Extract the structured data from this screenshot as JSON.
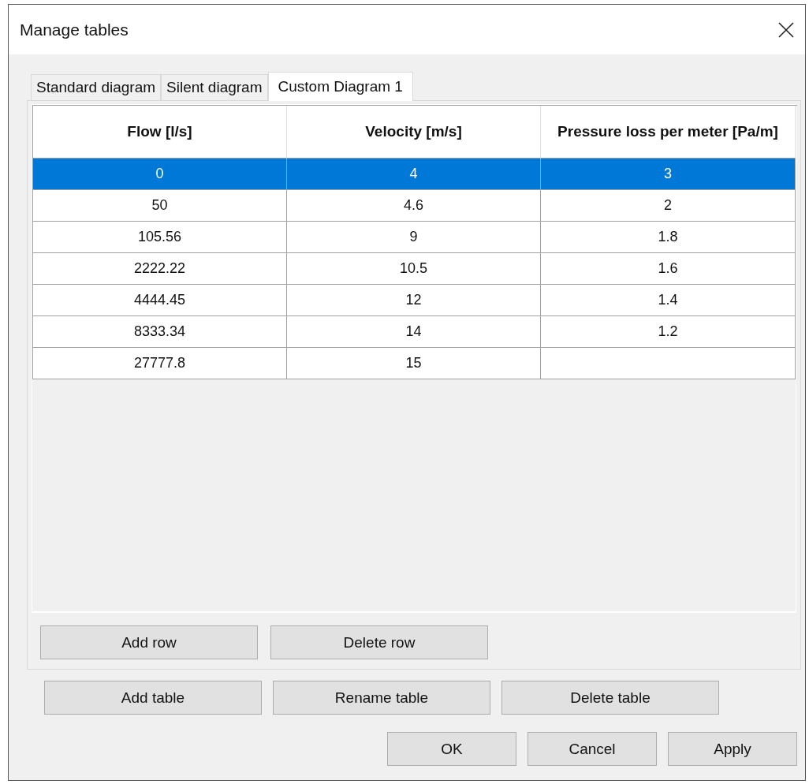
{
  "window": {
    "title": "Manage tables"
  },
  "tabs": [
    {
      "label": "Standard diagram",
      "selected": false
    },
    {
      "label": "Silent diagram",
      "selected": false
    },
    {
      "label": "Custom Diagram 1",
      "selected": true
    }
  ],
  "table": {
    "columns": [
      "Flow [l/s]",
      "Velocity [m/s]",
      "Pressure loss per meter [Pa/m]"
    ],
    "rows": [
      {
        "cells": [
          "0",
          "4",
          "3"
        ],
        "selected": true
      },
      {
        "cells": [
          "50",
          "4.6",
          "2"
        ],
        "selected": false
      },
      {
        "cells": [
          "105.56",
          "9",
          "1.8"
        ],
        "selected": false
      },
      {
        "cells": [
          "2222.22",
          "10.5",
          "1.6"
        ],
        "selected": false
      },
      {
        "cells": [
          "4444.45",
          "12",
          "1.4"
        ],
        "selected": false
      },
      {
        "cells": [
          "8333.34",
          "14",
          "1.2"
        ],
        "selected": false
      },
      {
        "cells": [
          "27777.8",
          "15",
          ""
        ],
        "selected": false
      }
    ]
  },
  "row_buttons": [
    "Add row",
    "Delete row"
  ],
  "table_buttons": [
    "Add table",
    "Rename table",
    "Delete table"
  ],
  "dialog_buttons": [
    "OK",
    "Cancel",
    "Apply"
  ]
}
